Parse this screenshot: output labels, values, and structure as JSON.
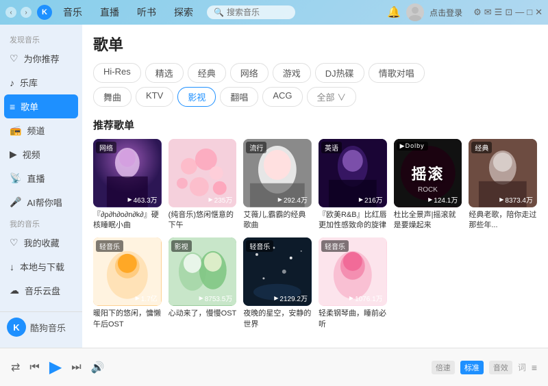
{
  "titlebar": {
    "logo": "K",
    "tabs": [
      "音乐",
      "直播",
      "听书",
      "探索"
    ],
    "active_tab": "音乐",
    "search_placeholder": "搜索音乐",
    "login_text": "点击登录",
    "window_controls": [
      "⊟",
      "—",
      "□",
      "✕"
    ]
  },
  "sidebar": {
    "discover_title": "发现音乐",
    "discover_items": [
      {
        "label": "为你推荐",
        "icon": "♡"
      },
      {
        "label": "乐库",
        "icon": "♪"
      },
      {
        "label": "歌单",
        "icon": "≡",
        "active": true
      },
      {
        "label": "频道",
        "icon": "📻"
      },
      {
        "label": "视频",
        "icon": "▶"
      },
      {
        "label": "直播",
        "icon": "📡"
      },
      {
        "label": "AI帮你唱",
        "icon": "🎤"
      }
    ],
    "my_music_title": "我的音乐",
    "my_items": [
      {
        "label": "我的收藏",
        "icon": "♡"
      },
      {
        "label": "本地与下载",
        "icon": "↓"
      },
      {
        "label": "音乐云盘",
        "icon": "☁"
      }
    ],
    "app_name": "酷狗音乐"
  },
  "content": {
    "page_title": "歌单",
    "filter_row1": [
      "Hi-Res",
      "精选",
      "经典",
      "网络",
      "游戏",
      "DJ热碟",
      "情歌对唱"
    ],
    "filter_row2": [
      "舞曲",
      "KTV",
      "影视",
      "翻唱",
      "ACG",
      "全部 ∨"
    ],
    "active_filter": "影视",
    "section_title": "推荐歌单",
    "playlists": [
      {
        "tag": "网络",
        "bg": "bg-purple",
        "count": "463.3万",
        "name": "『∂ρ∂h∂o∂n∂k∂』硬核睡眠小曲",
        "has_image": true,
        "image_type": "anime_girl"
      },
      {
        "tag": "",
        "bg": "bg-pink",
        "count": "235万",
        "name": "(纯音乐)悠闲惬意的下午",
        "has_image": true,
        "image_type": "flowers"
      },
      {
        "tag": "流行",
        "bg": "bg-blue",
        "count": "292.4万",
        "name": "艾薇儿,霸霸的经典歌曲",
        "has_image": true,
        "image_type": "blonde_singer"
      },
      {
        "tag": "英语",
        "bg": "bg-dark",
        "count": "216万",
        "name": "『欧美R&B』比红唇更加性感致命的旋律",
        "has_image": true,
        "image_type": "dark_portrait"
      },
      {
        "tag": "",
        "bg": "bg-red",
        "count": "124.1万",
        "name": "杜比全景声|摇滚就是要燥起来",
        "has_image": true,
        "image_type": "rock",
        "dolby": true,
        "overlay": "摇滚\nROCK"
      },
      {
        "tag": "经典",
        "bg": "bg-warm",
        "count": "8373.4万",
        "name": "经典老歌，陪你走过那些年...",
        "has_image": true,
        "image_type": "old_man"
      },
      {
        "tag": "轻音乐",
        "bg": "bg-orange",
        "count": "1.7亿",
        "name": "暖阳下的悠闲，慵懒午后OST",
        "has_image": true,
        "image_type": "dog_cartoon"
      },
      {
        "tag": "影视",
        "bg": "bg-green",
        "count": "8753.5万",
        "name": "心动来了，慢慢OST",
        "has_image": true,
        "image_type": "drama_couple"
      },
      {
        "tag": "轻音乐",
        "bg": "bg-slate",
        "count": "2129.2万",
        "name": "夜晚的星空，安静的世界",
        "has_image": true,
        "image_type": "stars"
      },
      {
        "tag": "轻音乐",
        "bg": "bg-lightpink",
        "count": "1076.1万",
        "name": "轻柔钢琴曲，睡前必听",
        "has_image": true,
        "image_type": "cartoon_girl"
      }
    ]
  },
  "player": {
    "shuffle": "⇄",
    "prev": "⏮",
    "play": "▶",
    "next": "⏭",
    "volume": "🔊",
    "speed_options": [
      "倍速",
      "标准",
      "音效"
    ],
    "active_speed": "标准",
    "lyrics": "词",
    "playlist": "≡"
  }
}
